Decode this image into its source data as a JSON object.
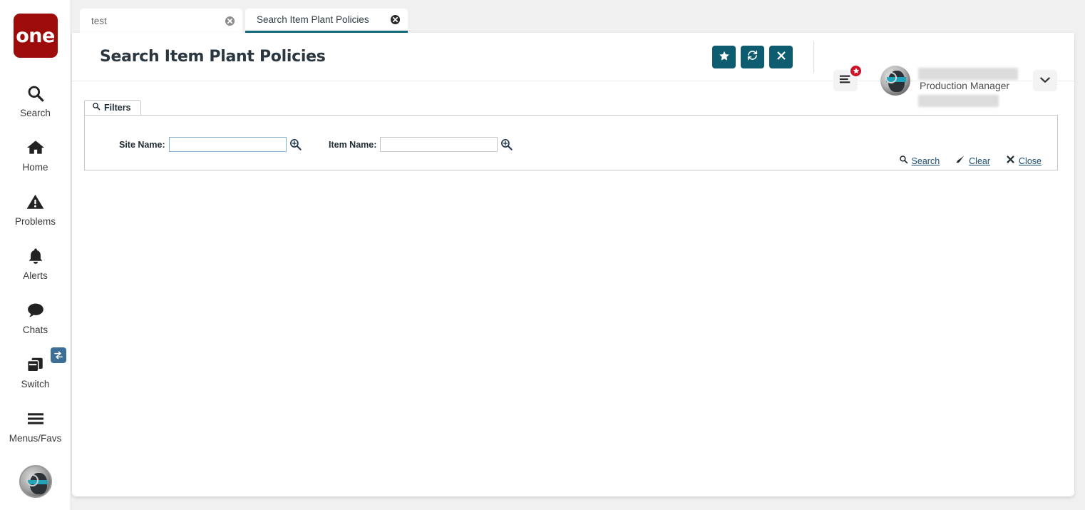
{
  "brand": {
    "logo_text": "one"
  },
  "sidebar": {
    "items": [
      {
        "label": "Search",
        "icon": "search-icon"
      },
      {
        "label": "Home",
        "icon": "home-icon"
      },
      {
        "label": "Problems",
        "icon": "warning-triangle-icon"
      },
      {
        "label": "Alerts",
        "icon": "bell-icon"
      },
      {
        "label": "Chats",
        "icon": "chat-bubble-icon"
      },
      {
        "label": "Switch",
        "icon": "windows-stack-icon"
      },
      {
        "label": "Menus/Favs",
        "icon": "hamburger-icon"
      }
    ],
    "switch_badge_icon": "swap-arrows-icon",
    "avatar_icon": "user-avatar"
  },
  "tabs": [
    {
      "label": "test",
      "active": false
    },
    {
      "label": "Search Item Plant Policies",
      "active": true
    }
  ],
  "header": {
    "title": "Search Item Plant Policies",
    "actions": [
      {
        "name": "favorite-button",
        "icon": "star-icon"
      },
      {
        "name": "refresh-button",
        "icon": "refresh-icon"
      },
      {
        "name": "close-button",
        "icon": "close-x-icon"
      }
    ],
    "menu_icon": "list-menu-icon",
    "menu_badge_icon": "star-icon",
    "user_role": "Production Manager",
    "user_chevron_icon": "chevron-down-icon"
  },
  "filters": {
    "tab_label": "Filters",
    "tab_icon": "search-icon",
    "fields": [
      {
        "label": "Site Name:",
        "value": "",
        "placeholder": "",
        "focused": true,
        "picker_icon": "zoom-in-icon"
      },
      {
        "label": "Item Name:",
        "value": "",
        "placeholder": "",
        "focused": false,
        "picker_icon": "zoom-in-icon"
      }
    ],
    "actions": [
      {
        "label": "Search",
        "icon": "search-icon"
      },
      {
        "label": "Clear",
        "icon": "eraser-icon"
      },
      {
        "label": "Close",
        "icon": "close-x-icon"
      }
    ]
  },
  "colors": {
    "brand_red": "#9e0b0b",
    "teal_action": "#0e5c70",
    "tab_active_underline": "#11697d",
    "badge_red": "#cf1126",
    "link_blue": "#1c4e70",
    "switch_badge_blue": "#3d6e96",
    "page_background": "#f0f0f0"
  }
}
